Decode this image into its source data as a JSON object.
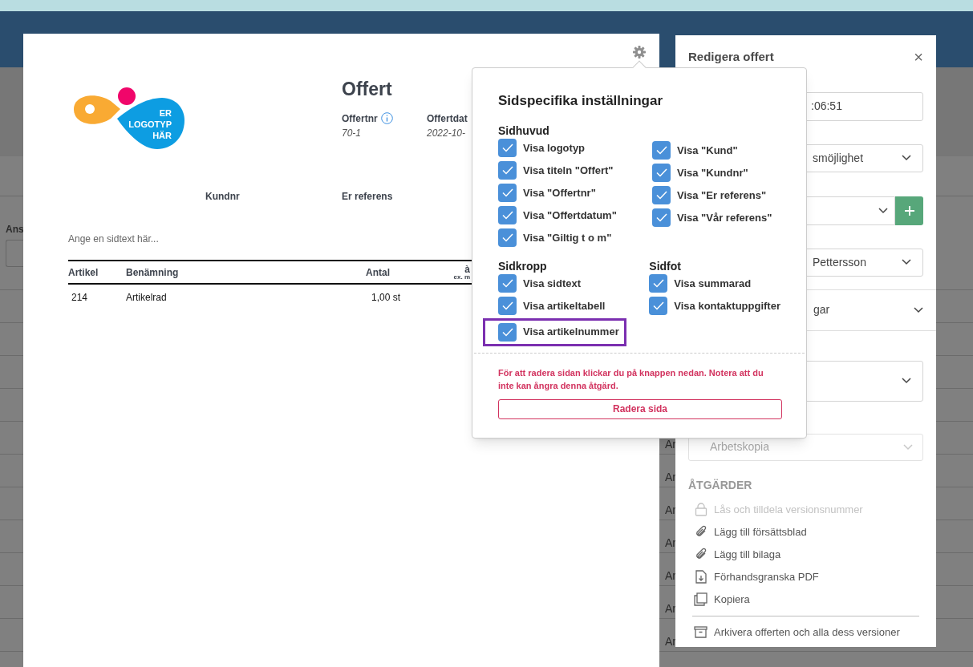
{
  "background": {
    "label": "Ans",
    "rows": [
      {
        "label": "Ar"
      },
      {
        "label": "Ar"
      },
      {
        "label": "Ar"
      },
      {
        "label": "Ar"
      },
      {
        "label": "Ar"
      },
      {
        "label": "Ar"
      },
      {
        "label": "Ar"
      }
    ]
  },
  "document": {
    "logo_lines": [
      "ER",
      "LOGOTYP",
      "HÄR"
    ],
    "title": "Offert",
    "meta": [
      {
        "label": "Offertnr",
        "value": "70-1",
        "info": true
      },
      {
        "label": "Offertdat",
        "value": "2022-10-",
        "info": false
      }
    ],
    "fields": [
      "Kundnr",
      "Er referens"
    ],
    "page_text_placeholder": "Ange en sidtext här...",
    "table": {
      "columns": [
        {
          "label": "Artikel"
        },
        {
          "label": "Benämning"
        },
        {
          "label": "Antal"
        },
        {
          "label": "à",
          "sub": "ex. m"
        }
      ],
      "rows": [
        [
          "214",
          "Artikelrad",
          "1,00 st"
        ]
      ]
    }
  },
  "popover": {
    "title": "Sidspecifika inställningar",
    "groups": [
      {
        "columns": [
          {
            "heading": "Sidhuvud",
            "items": [
              {
                "label": "Visa logotyp",
                "checked": true,
                "highlighted": false
              },
              {
                "label": "Visa titeln \"Offert\"",
                "checked": true,
                "highlighted": false
              },
              {
                "label": "Visa \"Offertnr\"",
                "checked": true,
                "highlighted": false
              },
              {
                "label": "Visa \"Offertdatum\"",
                "checked": true,
                "highlighted": false
              },
              {
                "label": "Visa \"Giltig t o m\"",
                "checked": true,
                "highlighted": false
              }
            ]
          },
          {
            "items": [
              {
                "label": "Visa \"Kund\"",
                "checked": true,
                "highlighted": false
              },
              {
                "label": "Visa \"Kundnr\"",
                "checked": true,
                "highlighted": false
              },
              {
                "label": "Visa \"Er referens\"",
                "checked": true,
                "highlighted": false
              },
              {
                "label": "Visa \"Vår referens\"",
                "checked": true,
                "highlighted": false
              }
            ]
          }
        ]
      },
      {
        "columns": [
          {
            "heading": "Sidkropp",
            "items": [
              {
                "label": "Visa sidtext",
                "checked": true,
                "highlighted": false
              },
              {
                "label": "Visa artikeltabell",
                "checked": true,
                "highlighted": false
              },
              {
                "label": "Visa artikelnummer",
                "checked": true,
                "highlighted": true
              }
            ]
          },
          {
            "heading": "Sidfot",
            "items": [
              {
                "label": "Visa summarad",
                "checked": true,
                "highlighted": false
              },
              {
                "label": "Visa kontaktuppgifter",
                "checked": true,
                "highlighted": false
              }
            ]
          }
        ]
      }
    ],
    "warning": "För att radera sidan klickar du på knappen nedan. Notera att du inte kan ångra denna åtgärd.",
    "delete_button": "Radera sida"
  },
  "edit_panel": {
    "title": "Redigera offert",
    "close": "×",
    "fields": [
      {
        "kind": "input",
        "value": ":06:51"
      },
      {
        "kind": "select",
        "value": "smöjlighet"
      },
      {
        "kind": "select-add"
      },
      {
        "kind": "select",
        "value": "Pettersson"
      },
      {
        "kind": "section",
        "value": "gar"
      },
      {
        "kind": "select-tall"
      },
      {
        "kind": "select-disabled",
        "value": "Arbetskopia"
      }
    ],
    "actions_heading": "ÅTGÄRDER",
    "actions": [
      {
        "label": "Lås och tilldela versionsnummer",
        "kind": "lock",
        "disabled": true,
        "separated": false
      },
      {
        "label": "Lägg till försättsblad",
        "kind": "attach",
        "disabled": false,
        "separated": false
      },
      {
        "label": "Lägg till bilaga",
        "kind": "attach",
        "disabled": false,
        "separated": false
      },
      {
        "label": "Förhandsgranska PDF",
        "kind": "preview",
        "disabled": false,
        "separated": false
      },
      {
        "label": "Kopiera",
        "kind": "copy",
        "disabled": false,
        "separated": false
      },
      {
        "label": "Arkivera offerten och alla dess versioner",
        "kind": "archive",
        "disabled": false,
        "separated": true
      }
    ]
  }
}
